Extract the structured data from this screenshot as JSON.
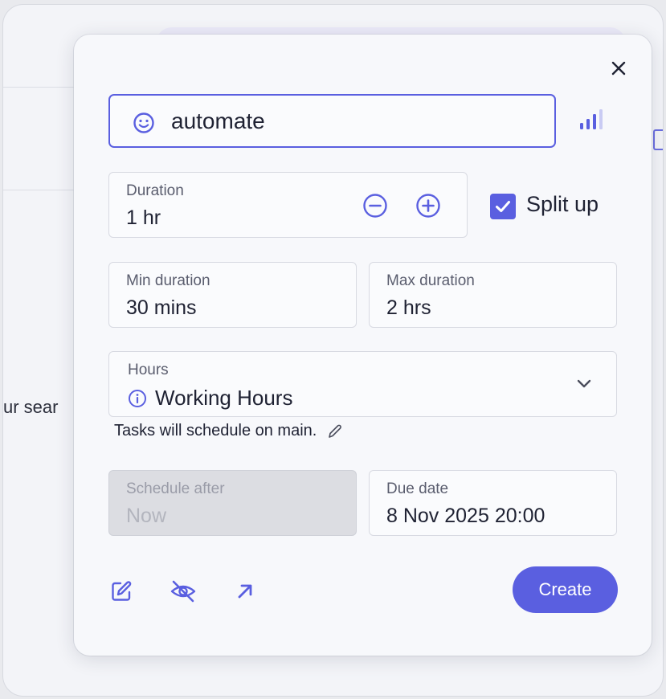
{
  "background": {
    "partial_search_text": "ur sear"
  },
  "task": {
    "name_value": "automate"
  },
  "duration": {
    "label": "Duration",
    "value": "1 hr"
  },
  "split_up": {
    "label": "Split up",
    "checked": true
  },
  "min_duration": {
    "label": "Min duration",
    "value": "30 mins"
  },
  "max_duration": {
    "label": "Max duration",
    "value": "2 hrs"
  },
  "hours": {
    "label": "Hours",
    "value": "Working Hours"
  },
  "schedule_note": "Tasks will schedule on main.",
  "schedule_after": {
    "label": "Schedule after",
    "value": "Now",
    "disabled": true
  },
  "due_date": {
    "label": "Due date",
    "value": "8 Nov 2025 20:00"
  },
  "buttons": {
    "create": "Create"
  },
  "icons": {
    "close": "close-icon",
    "smiley": "smiley-icon",
    "priority": "signal-bars-icon",
    "decrement": "minus-circle-icon",
    "increment": "plus-circle-icon",
    "info": "info-icon",
    "chevron": "chevron-down-icon",
    "edit_note": "pencil-icon",
    "edit": "edit-icon",
    "hidden": "eye-off-icon",
    "open": "arrow-up-right-icon"
  },
  "colors": {
    "accent": "#5a5fe0",
    "background": "#f7f8fb",
    "disabled_field": "#dcdde2"
  }
}
